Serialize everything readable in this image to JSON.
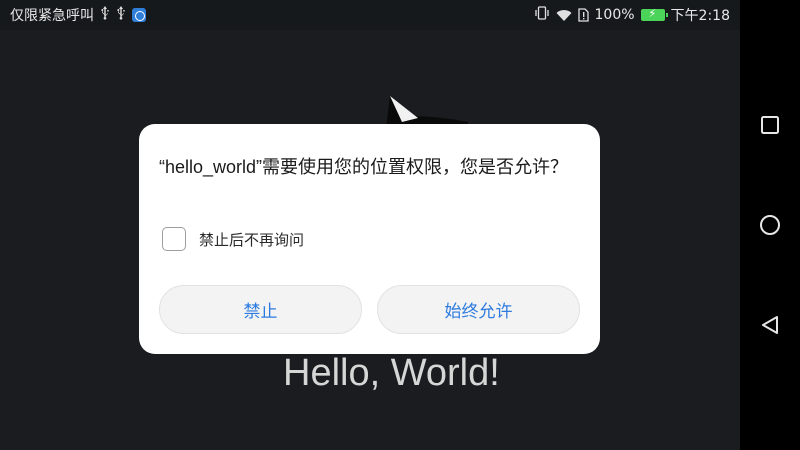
{
  "status_bar": {
    "notification_text": "仅限紧急呼叫",
    "usb_icon_1": "usb-icon",
    "usb_icon_2": "usb-icon",
    "app_icon": "app-notification-icon",
    "battery_percent": "100%",
    "time": "下午2:18",
    "battery_color": "#4cd45a"
  },
  "app": {
    "hello_text": "Hello, World!",
    "background_color": "#1a1c20"
  },
  "dialog": {
    "message": "“hello_world”需要使用您的位置权限，您是否允许？",
    "checkbox_label": "禁止后不再询问",
    "deny_label": "禁止",
    "allow_label": "始终允许",
    "accent_color": "#2d7be0"
  },
  "nav_bar": {
    "recents_icon": "square-icon",
    "home_icon": "circle-icon",
    "back_icon": "triangle-back-icon"
  }
}
